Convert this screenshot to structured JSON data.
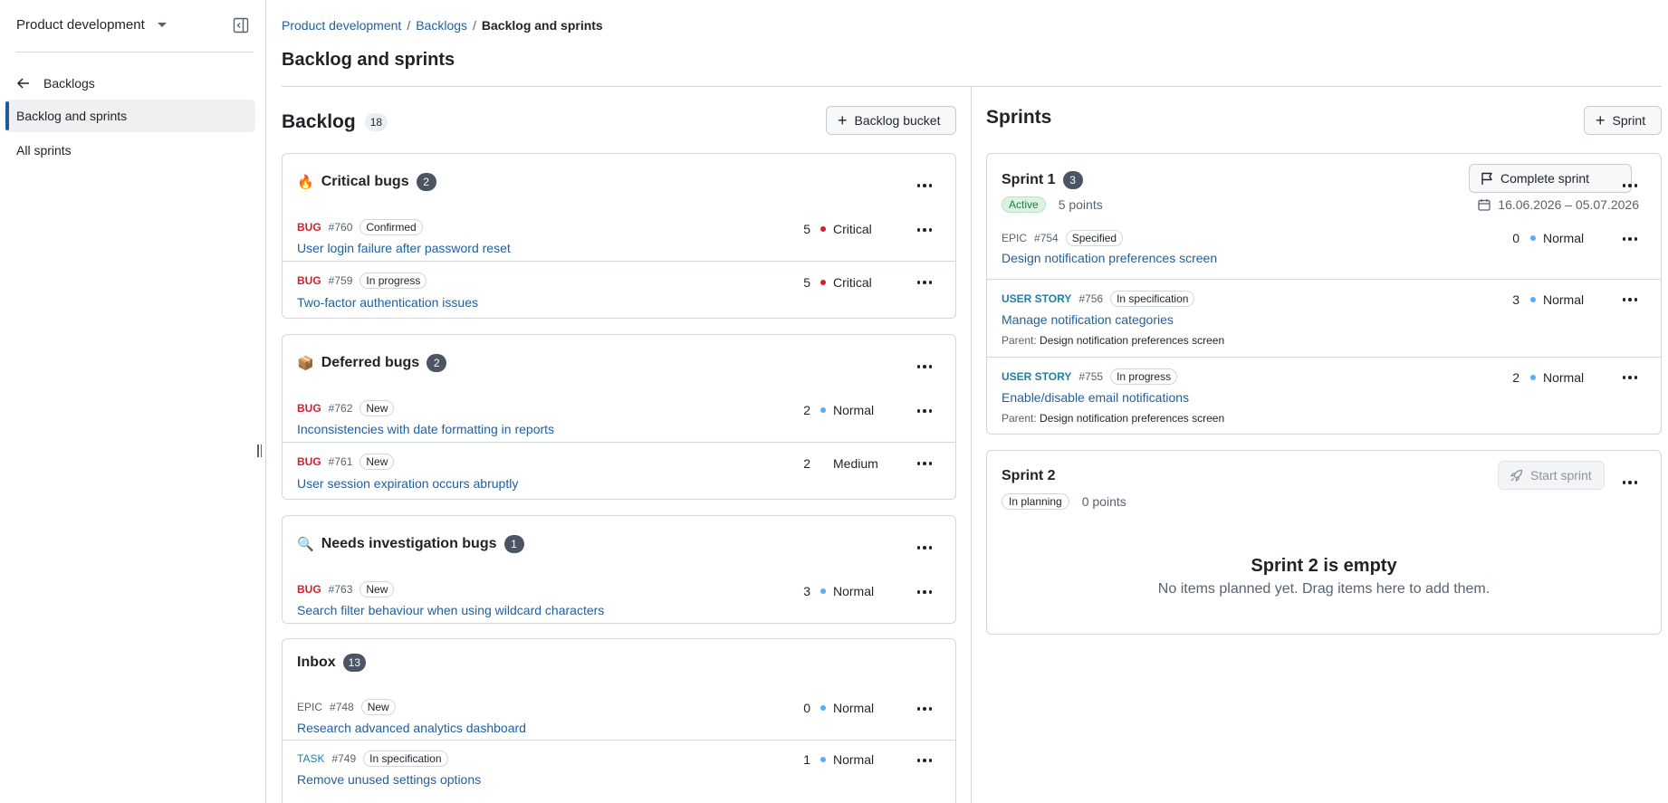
{
  "sidebar": {
    "project": "Product development",
    "back_label": "Backlogs",
    "items": [
      {
        "label": "Backlog and sprints",
        "active": true
      },
      {
        "label": "All sprints",
        "active": false
      }
    ]
  },
  "breadcrumb": [
    "Product development",
    "Backlogs",
    "Backlog and sprints"
  ],
  "page_title": "Backlog and sprints",
  "backlog": {
    "title": "Backlog",
    "count": "18",
    "add_bucket_label": "Backlog bucket",
    "buckets": [
      {
        "emoji": "🔥",
        "title": "Critical bugs",
        "count": "2",
        "items": [
          {
            "type": "BUG",
            "id": "#760",
            "status": "Confirmed",
            "title": "User login failure after password reset",
            "points": "5",
            "priority": "Critical",
            "prio_color": "#cf222e"
          },
          {
            "type": "BUG",
            "id": "#759",
            "status": "In progress",
            "title": "Two-factor authentication issues",
            "points": "5",
            "priority": "Critical",
            "prio_color": "#cf222e"
          }
        ]
      },
      {
        "emoji": "📦",
        "title": "Deferred bugs",
        "count": "2",
        "items": [
          {
            "type": "BUG",
            "id": "#762",
            "status": "New",
            "title": "Inconsistencies with date formatting in reports",
            "points": "2",
            "priority": "Normal",
            "prio_color": "#54aeff"
          },
          {
            "type": "BUG",
            "id": "#761",
            "status": "New",
            "title": "User session expiration occurs abruptly",
            "points": "2",
            "priority": "Medium",
            "prio_color": ""
          }
        ]
      },
      {
        "emoji": "🔍",
        "title": "Needs investigation bugs",
        "count": "1",
        "items": [
          {
            "type": "BUG",
            "id": "#763",
            "status": "New",
            "title": "Search filter behaviour when using wildcard characters",
            "points": "3",
            "priority": "Normal",
            "prio_color": "#54aeff"
          }
        ]
      },
      {
        "emoji": "",
        "title": "Inbox",
        "count": "13",
        "items": [
          {
            "type": "EPIC",
            "id": "#748",
            "status": "New",
            "title": "Research advanced analytics dashboard",
            "points": "0",
            "priority": "Normal",
            "prio_color": "#54aeff"
          },
          {
            "type": "TASK",
            "id": "#749",
            "status": "In specification",
            "title": "Remove unused settings options",
            "points": "1",
            "priority": "Normal",
            "prio_color": "#54aeff"
          }
        ]
      }
    ]
  },
  "sprints": {
    "title": "Sprints",
    "add_label": "Sprint",
    "list": [
      {
        "title": "Sprint 1",
        "count": "3",
        "state": "Active",
        "points": "5 points",
        "action_label": "Complete sprint",
        "dates": "16.06.2026 – 05.07.2026",
        "items": [
          {
            "type": "EPIC",
            "id": "#754",
            "status": "Specified",
            "title": "Design notification preferences screen",
            "points": "0",
            "priority": "Normal",
            "prio_color": "#54aeff",
            "parent_label": "",
            "parent": ""
          },
          {
            "type": "USER STORY",
            "id": "#756",
            "status": "In specification",
            "title": "Manage notification categories",
            "points": "3",
            "priority": "Normal",
            "prio_color": "#54aeff",
            "parent_label": "Parent:",
            "parent": "Design notification preferences screen"
          },
          {
            "type": "USER STORY",
            "id": "#755",
            "status": "In progress",
            "title": "Enable/disable email notifications",
            "points": "2",
            "priority": "Normal",
            "prio_color": "#54aeff",
            "parent_label": "Parent:",
            "parent": "Design notification preferences screen"
          }
        ]
      },
      {
        "title": "Sprint 2",
        "state": "In planning",
        "points": "0 points",
        "action_label": "Start sprint",
        "empty_title": "Sprint 2 is empty",
        "empty_sub": "No items planned yet. Drag items here to add them."
      }
    ]
  }
}
